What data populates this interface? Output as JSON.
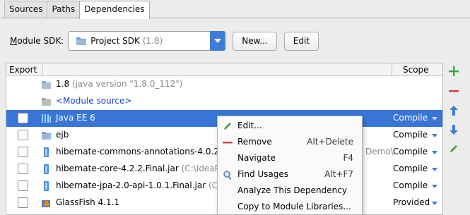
{
  "tabs": [
    {
      "label": "Sources"
    },
    {
      "label": "Paths"
    },
    {
      "label": "Dependencies"
    }
  ],
  "module_sdk": {
    "label_prefix": "M",
    "label_rest": "odule SDK:",
    "value": "Project SDK",
    "version": "(1.8)",
    "new_label": "New...",
    "edit_label": "Edit"
  },
  "table": {
    "col_export": "Export",
    "col_scope": "Scope",
    "rows": [
      {
        "name": "1.8",
        "detail": " (java version \"1.8.0_112\")",
        "scope": "",
        "checkbox": false
      },
      {
        "name": "<Module source>",
        "detail": "",
        "scope": "",
        "checkbox": false
      },
      {
        "name": "Java EE 6",
        "detail": "",
        "scope": "Compile",
        "checkbox": true
      },
      {
        "name": "ejb",
        "detail": "",
        "scope": "Compile",
        "checkbox": true
      },
      {
        "name": "hibernate-commons-annotations-4.0.2",
        "detail": "",
        "trail": "Demo\\",
        "scope": "Compile",
        "checkbox": true
      },
      {
        "name": "hibernate-core-4.2.2.Final.jar",
        "detail": " (C:\\IdeaPr",
        "scope": "Compile",
        "checkbox": true
      },
      {
        "name": "hibernate-jpa-2.0-api-1.0.1.Final.jar",
        "detail": " (C:\\",
        "scope": "Compile",
        "checkbox": true
      },
      {
        "name": "GlassFish 4.1.1",
        "detail": "",
        "scope": "Provided",
        "checkbox": true
      }
    ]
  },
  "context_menu": [
    {
      "label": "Edit...",
      "shortcut": ""
    },
    {
      "label": "Remove",
      "shortcut": "Alt+Delete"
    },
    {
      "label": "Navigate",
      "shortcut": "F4"
    },
    {
      "label": "Find Usages",
      "shortcut": "Alt+F7"
    },
    {
      "label": "Analyze This Dependency",
      "shortcut": ""
    },
    {
      "label": "Copy to Module Libraries...",
      "shortcut": ""
    }
  ],
  "colors": {
    "selection": "#3875d7",
    "add": "#3aa83a",
    "remove": "#d64040",
    "move": "#3d7dd8",
    "edit": "#4aa33a"
  }
}
